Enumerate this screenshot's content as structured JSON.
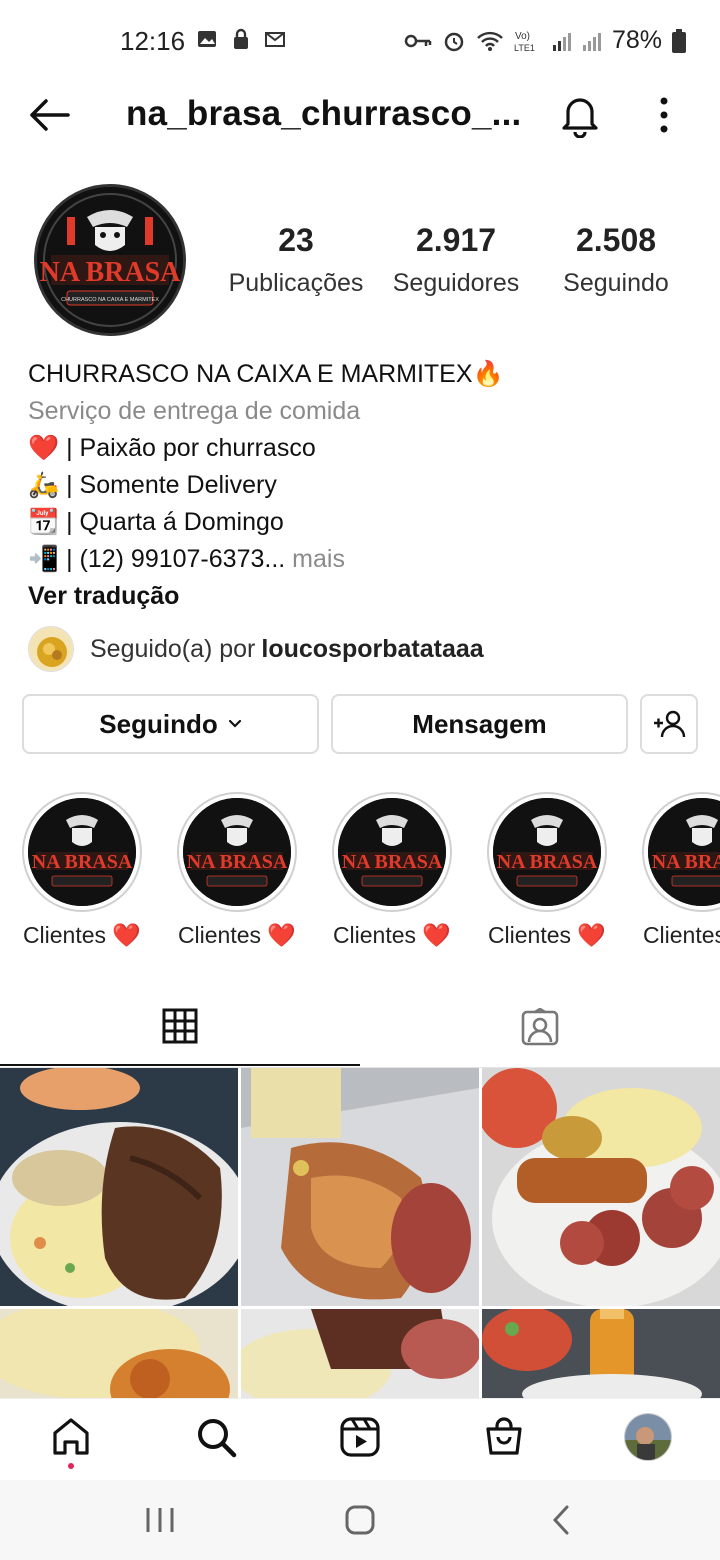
{
  "status_bar": {
    "time": "12:16",
    "battery": "78%",
    "left_icons": [
      "gallery-icon",
      "lock-icon",
      "gmail-icon"
    ],
    "right_icons": [
      "key-icon",
      "alarm-icon",
      "wifi-icon",
      "volte-icon",
      "signal-icon",
      "signal-icon-2",
      "battery-icon"
    ]
  },
  "header": {
    "title": "na_brasa_churrasco_...",
    "back_icon": "arrow-left-icon",
    "bell_icon": "bell-icon",
    "more_icon": "more-vertical-icon"
  },
  "profile": {
    "avatar_logo_text": "NA BRASA",
    "avatar_logo_subtext": "CHURRASCO NA CAIXA E MARMITEX",
    "stats": [
      {
        "value": "23",
        "label": "Publicações"
      },
      {
        "value": "2.917",
        "label": "Seguidores"
      },
      {
        "value": "2.508",
        "label": "Seguindo"
      }
    ],
    "bio": {
      "name": "CHURRASCO NA CAIXA E MARMITEX🔥",
      "category": "Serviço de entrega de comida",
      "lines": [
        "❤️ | Paixão por churrasco",
        "🛵 | Somente Delivery",
        "📆 | Quarta á Domingo"
      ],
      "phone_line": "📲 | (12) 99107-6373...",
      "more": " mais",
      "translate": "Ver tradução"
    },
    "followed_by": {
      "prefix": "Seguido(a) por ",
      "username": "loucosporbatataaa"
    }
  },
  "actions": {
    "following": "Seguindo",
    "message": "Mensagem"
  },
  "highlights": [
    {
      "label": "Clientes ❤️"
    },
    {
      "label": "Clientes ❤️"
    },
    {
      "label": "Clientes ❤️"
    },
    {
      "label": "Clientes ❤️"
    },
    {
      "label": "Clientes ❤️"
    }
  ],
  "tabs": {
    "grid_icon": "grid-icon",
    "tagged_icon": "tagged-person-icon"
  },
  "bottom_nav": {
    "items": [
      "home-icon",
      "search-icon",
      "reels-icon",
      "shop-icon",
      "profile-avatar"
    ]
  },
  "colors": {
    "logo_red": "#e03a2a",
    "logo_bg": "#111111",
    "notification_dot": "#e0245e"
  }
}
